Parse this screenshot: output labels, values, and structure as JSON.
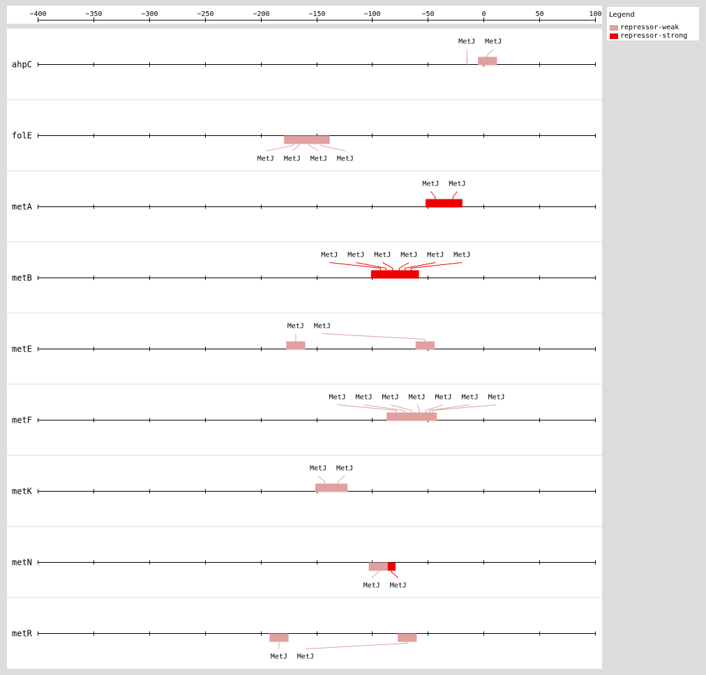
{
  "axis": {
    "ticks": [
      -400,
      -350,
      -300,
      -250,
      -200,
      -150,
      -100,
      -50,
      0,
      50,
      100
    ],
    "tick_labels": [
      "−400",
      "−350",
      "−300",
      "−250",
      "−200",
      "−150",
      "−100",
      "−50",
      "0",
      "50",
      "100"
    ],
    "range": [
      -400,
      100
    ]
  },
  "legend": {
    "title": "Legend",
    "items": [
      {
        "label": "repressor-weak",
        "color": "#e0a0a0"
      },
      {
        "label": "repressor-strong",
        "color": "#ee0000"
      }
    ]
  },
  "colors": {
    "weak": "#e0a0a0",
    "strong": "#ee0000",
    "track": "#000000",
    "divider": "#dddddd"
  },
  "tracks": [
    {
      "gene": "ahpC",
      "sites": [
        {
          "start": -15,
          "end": -15,
          "type": "weak",
          "label": "MetJ",
          "label_pos": "above"
        },
        {
          "start": -5,
          "end": 12,
          "type": "weak",
          "label": "MetJ",
          "label_pos": "above"
        }
      ]
    },
    {
      "gene": "folE",
      "sites": [
        {
          "start": -179,
          "end": -162,
          "type": "weak",
          "label": "MetJ",
          "label_pos": "below"
        },
        {
          "start": -174,
          "end": -157,
          "type": "weak",
          "label": "MetJ",
          "label_pos": "below"
        },
        {
          "start": -165,
          "end": -148,
          "type": "weak",
          "label": "MetJ",
          "label_pos": "below"
        },
        {
          "start": -155,
          "end": -138,
          "type": "weak",
          "label": "MetJ",
          "label_pos": "below"
        }
      ]
    },
    {
      "gene": "metA",
      "sites": [
        {
          "start": -52,
          "end": -35,
          "type": "strong",
          "label": "MetJ",
          "label_pos": "above"
        },
        {
          "start": -36,
          "end": -19,
          "type": "strong",
          "label": "MetJ",
          "label_pos": "above"
        }
      ]
    },
    {
      "gene": "metB",
      "sites": [
        {
          "start": -101,
          "end": -84,
          "type": "strong",
          "label": "MetJ",
          "label_pos": "above"
        },
        {
          "start": -96,
          "end": -79,
          "type": "strong",
          "label": "MetJ",
          "label_pos": "above"
        },
        {
          "start": -90,
          "end": -73,
          "type": "strong",
          "label": "MetJ",
          "label_pos": "above"
        },
        {
          "start": -84,
          "end": -67,
          "type": "strong",
          "label": "MetJ",
          "label_pos": "above"
        },
        {
          "start": -78,
          "end": -63,
          "type": "strong",
          "label": "MetJ",
          "label_pos": "above"
        },
        {
          "start": -72,
          "end": -58,
          "type": "strong",
          "label": "MetJ",
          "label_pos": "above"
        }
      ]
    },
    {
      "gene": "metE",
      "sites": [
        {
          "start": -177,
          "end": -160,
          "type": "weak",
          "label": "MetJ",
          "label_pos": "above"
        },
        {
          "start": -61,
          "end": -44,
          "type": "weak",
          "label": "MetJ",
          "label_pos": "above"
        }
      ]
    },
    {
      "gene": "metF",
      "sites": [
        {
          "start": -87,
          "end": -70,
          "type": "weak",
          "label": "MetJ",
          "label_pos": "above"
        },
        {
          "start": -80,
          "end": -63,
          "type": "weak",
          "label": "MetJ",
          "label_pos": "above"
        },
        {
          "start": -73,
          "end": -56,
          "type": "weak",
          "label": "MetJ",
          "label_pos": "above"
        },
        {
          "start": -66,
          "end": -49,
          "type": "weak",
          "label": "MetJ",
          "label_pos": "above"
        },
        {
          "start": -60,
          "end": -44,
          "type": "weak",
          "label": "MetJ",
          "label_pos": "above"
        },
        {
          "start": -55,
          "end": -42,
          "type": "weak",
          "label": "MetJ",
          "label_pos": "above"
        },
        {
          "start": -50,
          "end": -42,
          "type": "weak",
          "label": "MetJ",
          "label_pos": "above"
        }
      ]
    },
    {
      "gene": "metK",
      "sites": [
        {
          "start": -151,
          "end": -134,
          "type": "weak",
          "label": "MetJ",
          "label_pos": "above"
        },
        {
          "start": -139,
          "end": -122,
          "type": "weak",
          "label": "MetJ",
          "label_pos": "above"
        }
      ]
    },
    {
      "gene": "metN",
      "sites": [
        {
          "start": -103,
          "end": -86,
          "type": "weak",
          "label": "MetJ",
          "label_pos": "below"
        },
        {
          "start": -86,
          "end": -79,
          "type": "strong",
          "label": "MetJ",
          "label_pos": "below"
        }
      ]
    },
    {
      "gene": "metR",
      "sites": [
        {
          "start": -192,
          "end": -175,
          "type": "weak",
          "label": "MetJ",
          "label_pos": "below"
        },
        {
          "start": -77,
          "end": -60,
          "type": "weak",
          "label": "MetJ",
          "label_pos": "below"
        }
      ]
    }
  ]
}
